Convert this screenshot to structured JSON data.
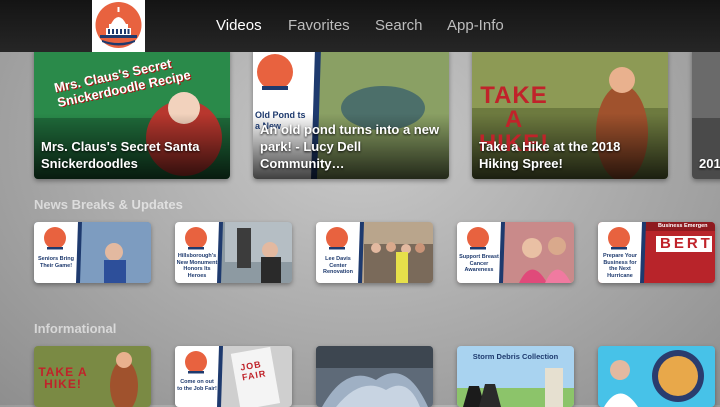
{
  "nav": {
    "logo_alt": "EST. 1834",
    "tabs": [
      {
        "label": "Videos",
        "active": true
      },
      {
        "label": "Favorites",
        "active": false
      },
      {
        "label": "Search",
        "active": false
      },
      {
        "label": "App-Info",
        "active": false
      }
    ]
  },
  "featured": [
    {
      "title": "Mrs. Claus's Secret Santa Snickerdoodles",
      "art": "Mrs. Claus's Secret Snickerdoodle Recipe"
    },
    {
      "title": "An old pond turns into a new park! - Lucy Dell Community…",
      "art": "Old Pond ts a New"
    },
    {
      "title": "Take a Hike at the 2018 Hiking Spree!",
      "art": "TAKE A HIKE!"
    },
    {
      "title": "201"
    }
  ],
  "sections": [
    {
      "title": "News Breaks & Updates",
      "items": [
        {
          "caption": "Seniors Bring Their Game!"
        },
        {
          "caption": "Hillsborough's New Monument Honors Its Heroes"
        },
        {
          "caption": "Lee Davis Center Renovation"
        },
        {
          "caption": "Support Breast Cancer Awareness"
        },
        {
          "caption": "Prepare Your Business for the Next Hurricane",
          "banner": "BERT",
          "banner_top": "Business Emergen"
        }
      ]
    },
    {
      "title": "Informational",
      "items": [
        {
          "art": "TAKE A HIKE!"
        },
        {
          "caption": "Come on out to the Job Fair!",
          "sign": "JOB FAIR"
        },
        {
          "art": ""
        },
        {
          "caption": "Storm Debris Collection"
        },
        {
          "art": ""
        }
      ]
    }
  ],
  "colors": {
    "nav_bg": "#1c1c1c",
    "seal_orange": "#e8623f",
    "seal_blue": "#1e3a6e",
    "accent_red": "#c0232a"
  }
}
